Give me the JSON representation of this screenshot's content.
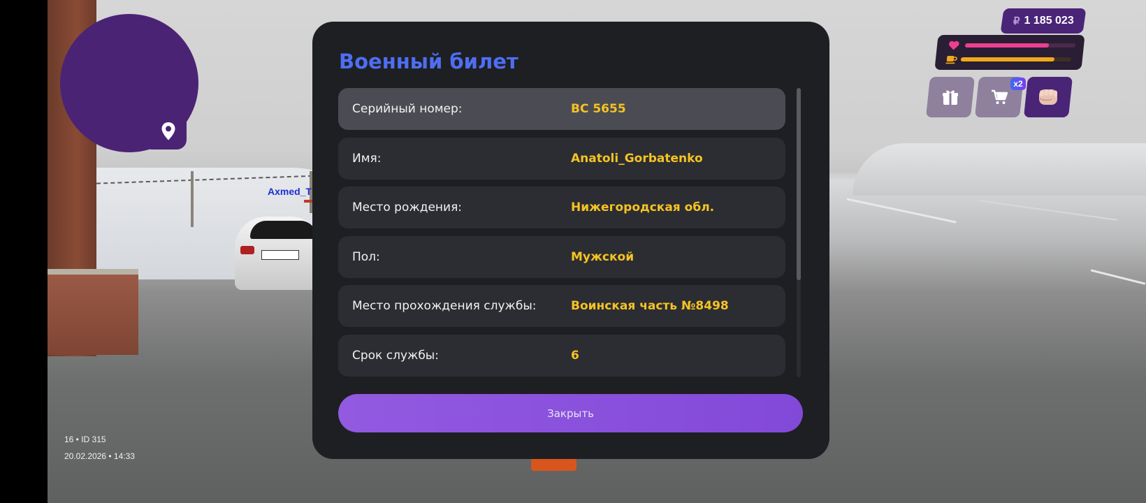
{
  "hud": {
    "money": "1 185 023",
    "currency_icon": "ruble-icon",
    "health_percent": 76,
    "hunger_percent": 85,
    "cart_badge": "x2",
    "server_info": "16 • ID 315",
    "datetime": "20.02.2026 • 14:33"
  },
  "world": {
    "player_nametag": "Axmed_T"
  },
  "modal": {
    "title": "Военный билет",
    "rows": [
      {
        "label": "Серийный номер:",
        "value": "BC 5655"
      },
      {
        "label": "Имя:",
        "value": "Anatoli_Gorbatenko"
      },
      {
        "label": "Место рождения:",
        "value": "Нижегородская обл."
      },
      {
        "label": "Пол:",
        "value": "Мужской"
      },
      {
        "label": "Место прохождения службы:",
        "value": "Воинская часть №8498"
      },
      {
        "label": "Срок службы:",
        "value": "6"
      }
    ],
    "close_label": "Закрыть"
  },
  "colors": {
    "title": "#4e6ef2",
    "value": "#f5c323",
    "button": "#8a51dc",
    "minimap": "#4b2374"
  }
}
